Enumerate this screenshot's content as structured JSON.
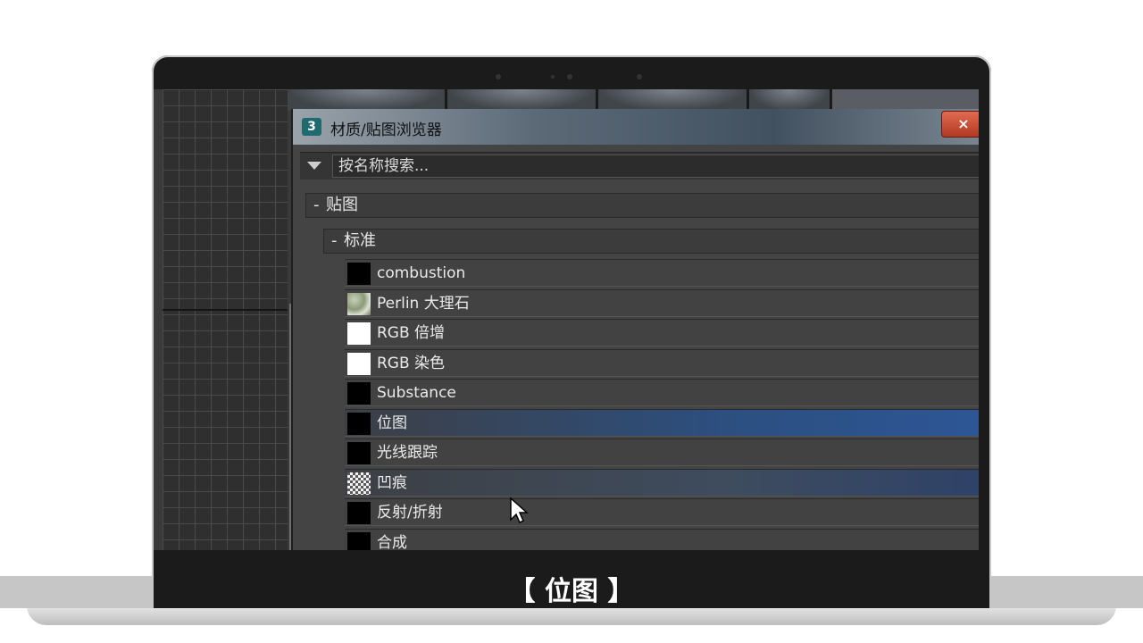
{
  "dialog": {
    "title": "材质/贴图浏览器",
    "close_label": "×",
    "search_placeholder": "按名称搜索..."
  },
  "groups": {
    "maps_label": "贴图",
    "maps_mark": "-",
    "standard_label": "标准",
    "standard_mark": "-"
  },
  "items": [
    {
      "name": "combustion",
      "swatch": "black"
    },
    {
      "name": "Perlin 大理石",
      "swatch": "marble"
    },
    {
      "name": "RGB 倍增",
      "swatch": "white"
    },
    {
      "name": "RGB 染色",
      "swatch": "white"
    },
    {
      "name": "Substance",
      "swatch": "black"
    },
    {
      "name": "位图",
      "swatch": "black",
      "state": "selected"
    },
    {
      "name": "光线跟踪",
      "swatch": "black"
    },
    {
      "name": "凹痕",
      "swatch": "noise",
      "state": "hover"
    },
    {
      "name": "反射/折射",
      "swatch": "black"
    },
    {
      "name": "合成",
      "swatch": "black"
    }
  ],
  "caption": "【 位图 】",
  "icons": {
    "app": "3ds-max-icon",
    "filter": "filter-dropdown-icon",
    "cursor": "mouse-pointer-icon"
  },
  "colors": {
    "selected_row": "#2d5696",
    "panel_bg": "#424242"
  }
}
